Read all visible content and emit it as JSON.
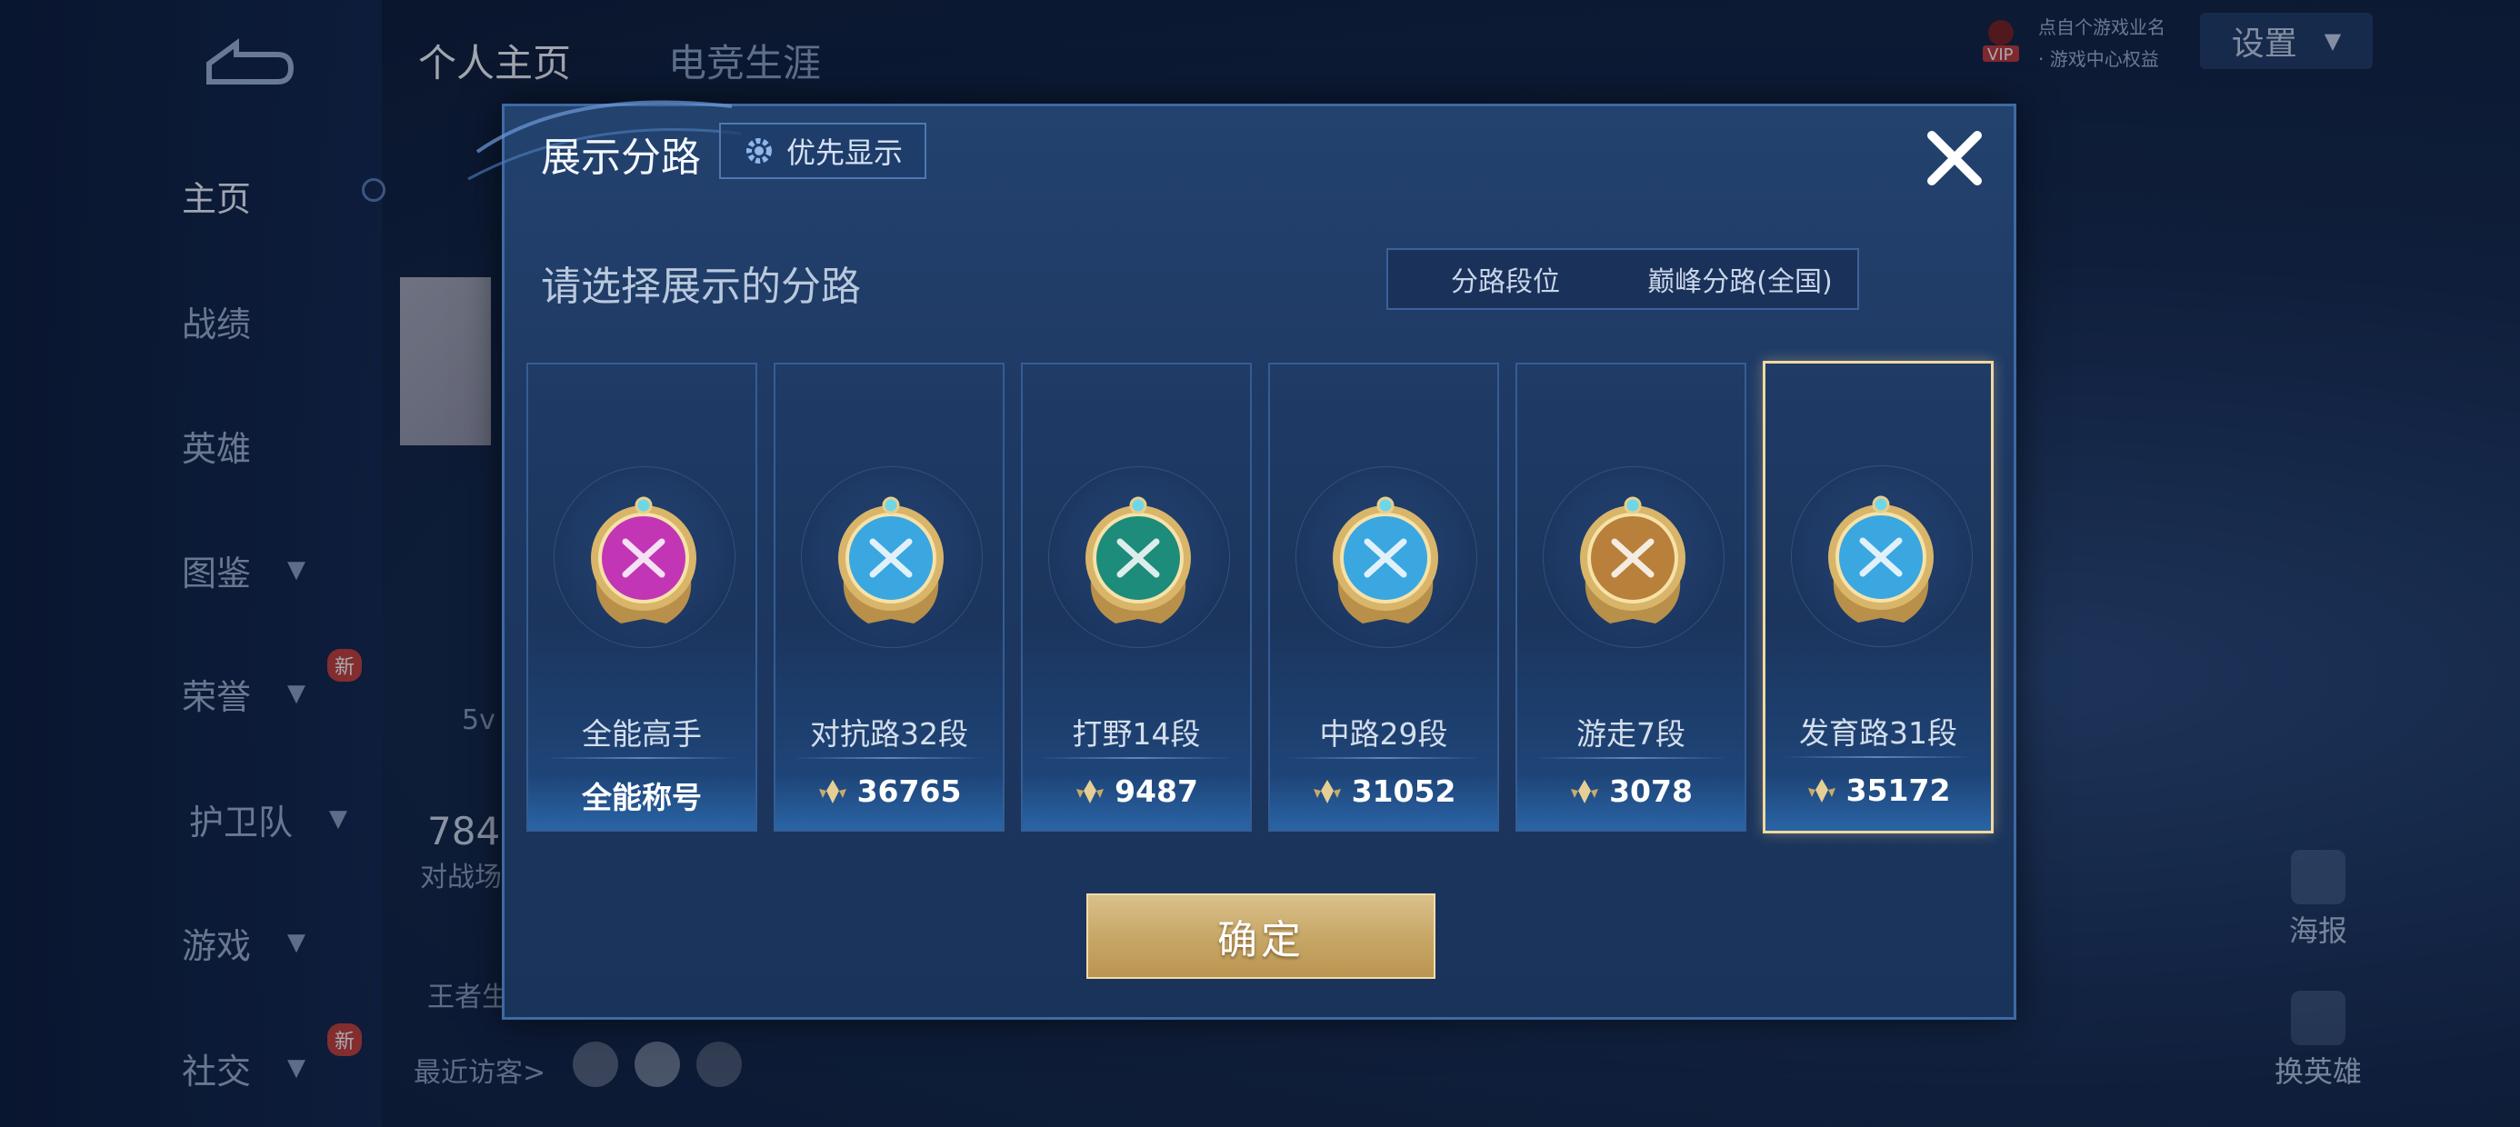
{
  "background": {
    "tabs": [
      "个人主页",
      "电竞生涯"
    ],
    "sidebar": [
      {
        "label": "主页",
        "active": true,
        "chevron": false,
        "new": false
      },
      {
        "label": "战绩",
        "active": false,
        "chevron": false,
        "new": false
      },
      {
        "label": "英雄",
        "active": false,
        "chevron": false,
        "new": false
      },
      {
        "label": "图鉴",
        "active": false,
        "chevron": true,
        "new": false
      },
      {
        "label": "荣誉",
        "active": false,
        "chevron": true,
        "new": true
      },
      {
        "label": "护卫队",
        "active": false,
        "chevron": true,
        "new": false
      },
      {
        "label": "游戏",
        "active": false,
        "chevron": true,
        "new": false
      },
      {
        "label": "社交",
        "active": false,
        "chevron": true,
        "new": true
      }
    ],
    "new_badge": "新",
    "settings_label": "设置",
    "vip_label": "VIP",
    "top_right_line1": "点自个游戏业名",
    "top_right_line2": "· 游戏中心权益",
    "left_text_5v": "5v",
    "left_number": "784",
    "left_caption": "对战场",
    "left_king": "王者生",
    "recent_visitors": "最近访客>",
    "poster_label": "海报",
    "swap_hero_label": "换英雄"
  },
  "modal": {
    "title": "展示分路",
    "priority_label": "优先显示",
    "subtitle": "请选择展示的分路",
    "segment": {
      "options": [
        "分路段位",
        "巅峰分路(全国)"
      ],
      "selected": 0
    },
    "cards": [
      {
        "label": "全能高手",
        "score": "全能称号",
        "has_icon": false,
        "badge_color": "#c236b5",
        "selected": false
      },
      {
        "label": "对抗路32段",
        "score": "36765",
        "has_icon": true,
        "badge_color": "#3aa7e0",
        "selected": false
      },
      {
        "label": "打野14段",
        "score": "9487",
        "has_icon": true,
        "badge_color": "#1d8c7a",
        "selected": false
      },
      {
        "label": "中路29段",
        "score": "31052",
        "has_icon": true,
        "badge_color": "#3aa7e0",
        "selected": false
      },
      {
        "label": "游走7段",
        "score": "3078",
        "has_icon": true,
        "badge_color": "#b8803a",
        "selected": false
      },
      {
        "label": "发育路31段",
        "score": "35172",
        "has_icon": true,
        "badge_color": "#3aa7e0",
        "selected": true
      }
    ],
    "confirm_label": "确定"
  }
}
